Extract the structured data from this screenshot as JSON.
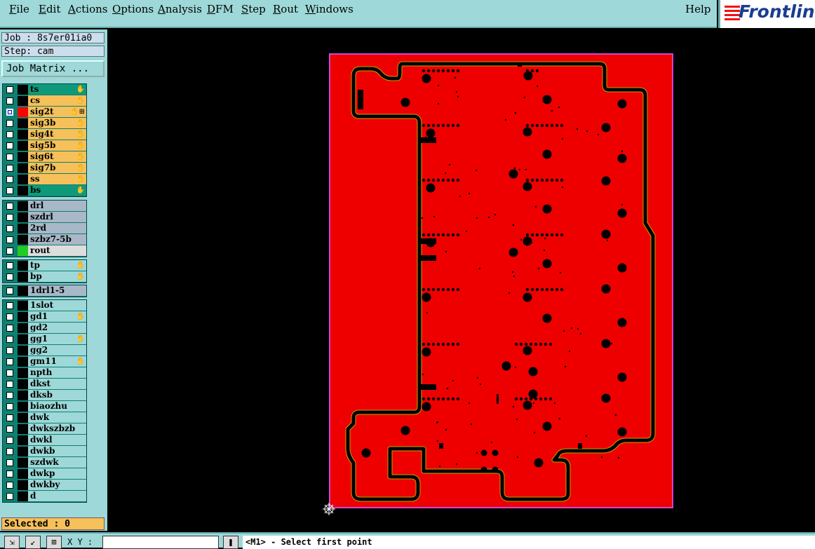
{
  "menu": {
    "items": [
      {
        "label": "File",
        "underline": "F",
        "rest": "ile"
      },
      {
        "label": "Edit",
        "underline": "E",
        "rest": "dit"
      },
      {
        "label": "Actions",
        "underline": "A",
        "rest": "ctions"
      },
      {
        "label": "Options",
        "underline": "O",
        "rest": "ptions"
      },
      {
        "label": "Analysis",
        "underline": "A",
        "rest": "nalysis"
      },
      {
        "label": "DFM",
        "underline": "D",
        "rest": "FM"
      },
      {
        "label": "Step",
        "underline": "S",
        "rest": "tep"
      },
      {
        "label": "Rout",
        "underline": "R",
        "rest": "out"
      },
      {
        "label": "Windows",
        "underline": "W",
        "rest": "indows"
      }
    ],
    "help": "Help",
    "logo": "Frontlin"
  },
  "job": {
    "label": "Job : 8s7er01ia0",
    "step": "Step: cam",
    "matrix_button": "Job Matrix ..."
  },
  "layer_groups": [
    {
      "layers": [
        {
          "name": "ts",
          "color": "#0e9a7a",
          "icon": "hand-icon"
        },
        {
          "name": "cs",
          "color": "#f6c05a",
          "icon": "hand-icon"
        },
        {
          "name": "sig2t",
          "color": "#f6c05a",
          "icon": "hand-icon",
          "selected": true,
          "swatch": "#ff0000"
        },
        {
          "name": "sig3b",
          "color": "#f6c05a",
          "icon": "hand-icon"
        },
        {
          "name": "sig4t",
          "color": "#f6c05a",
          "icon": "hand-icon"
        },
        {
          "name": "sig5b",
          "color": "#f6c05a",
          "icon": "hand-icon"
        },
        {
          "name": "sig6t",
          "color": "#f6c05a",
          "icon": "hand-icon"
        },
        {
          "name": "sig7b",
          "color": "#f6c05a",
          "icon": "hand-icon"
        },
        {
          "name": "ss",
          "color": "#f6c05a",
          "icon": "hand-icon"
        },
        {
          "name": "bs",
          "color": "#0e9a7a",
          "icon": "hand-icon"
        }
      ]
    },
    {
      "layers": [
        {
          "name": "drl",
          "color": "#a8b8c8"
        },
        {
          "name": "szdrl",
          "color": "#a8b8c8"
        },
        {
          "name": "2rd",
          "color": "#a8b8c8"
        },
        {
          "name": "szbz7-5b",
          "color": "#a8b8c8"
        },
        {
          "name": "rout",
          "color": "#dddddd",
          "swatch": "#22cc22"
        }
      ]
    },
    {
      "layers": [
        {
          "name": "tp",
          "color": "#9ed8d8",
          "icon": "hand-icon"
        },
        {
          "name": "bp",
          "color": "#9ed8d8",
          "icon": "hand-icon"
        }
      ]
    },
    {
      "layers": [
        {
          "name": "1drl1-5",
          "color": "#a8b8c8"
        }
      ]
    },
    {
      "layers": [
        {
          "name": "1slot",
          "color": "#9ed8d8"
        },
        {
          "name": "gd1",
          "color": "#9ed8d8",
          "icon": "hand-icon"
        },
        {
          "name": "gd2",
          "color": "#9ed8d8"
        },
        {
          "name": "gg1",
          "color": "#9ed8d8",
          "icon": "hand-icon"
        },
        {
          "name": "gg2",
          "color": "#9ed8d8"
        },
        {
          "name": "gm11",
          "color": "#9ed8d8",
          "icon": "hand-icon"
        },
        {
          "name": "npth",
          "color": "#9ed8d8"
        },
        {
          "name": "dkst",
          "color": "#9ed8d8"
        },
        {
          "name": "dksb",
          "color": "#9ed8d8"
        },
        {
          "name": "biaozhu",
          "color": "#9ed8d8"
        },
        {
          "name": "dwk",
          "color": "#9ed8d8"
        },
        {
          "name": "dwkszbzb",
          "color": "#9ed8d8"
        },
        {
          "name": "dwkl",
          "color": "#9ed8d8"
        },
        {
          "name": "dwkb",
          "color": "#9ed8d8"
        },
        {
          "name": "szdwk",
          "color": "#9ed8d8"
        },
        {
          "name": "dwkp",
          "color": "#9ed8d8"
        },
        {
          "name": "dwkby",
          "color": "#9ed8d8"
        },
        {
          "name": "d",
          "color": "#9ed8d8"
        }
      ]
    }
  ],
  "selected_count": "Selected : 0",
  "board": {
    "fill": "#ee0000",
    "outline": "#d046d0",
    "trace": "#000000",
    "trace_edge": "#c8a000"
  },
  "bottom": {
    "xy_label": "X Y :",
    "xy_value": "",
    "prompt": "<M1> - Select first point"
  }
}
